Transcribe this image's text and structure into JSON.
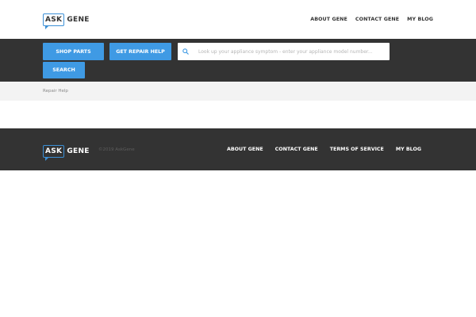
{
  "header": {
    "logo": {
      "part1": "ASK",
      "part2": "GENE"
    },
    "nav": [
      "ABOUT GENE",
      "CONTACT GENE",
      "MY BLOG"
    ]
  },
  "action_bar": {
    "shop_parts_label": "SHOP PARTS",
    "repair_help_label": "GET REPAIR HELP",
    "search_placeholder": "Look up your appliance symptom - enter your appliance model number...",
    "search_value": "",
    "search_label": "SEARCH",
    "search_icon": "search-icon"
  },
  "breadcrumb": {
    "item": "Repair Help"
  },
  "footer": {
    "logo": {
      "part1": "ASK",
      "part2": "GENE"
    },
    "copyright": "©2019 AskGene",
    "nav": [
      "ABOUT GENE",
      "CONTACT GENE",
      "TERMS OF SERVICE",
      "MY BLOG"
    ]
  },
  "colors": {
    "accent": "#3f9ae4",
    "dark_bar": "#333333",
    "light_bar": "#f3f3f3"
  }
}
